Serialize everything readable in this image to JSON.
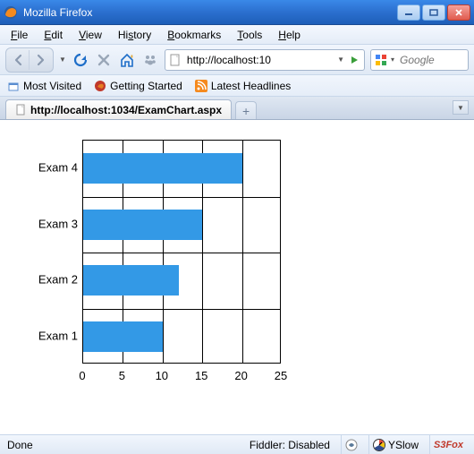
{
  "window": {
    "title": "Mozilla Firefox"
  },
  "menubar": [
    "File",
    "Edit",
    "View",
    "History",
    "Bookmarks",
    "Tools",
    "Help"
  ],
  "toolbar": {
    "reload_icon": "reload-icon",
    "stop_icon": "stop-icon",
    "home_icon": "home-icon",
    "feed_icon": "feed-icon"
  },
  "urlbar": {
    "value": "http://localhost:10"
  },
  "searchbar": {
    "placeholder": "Google"
  },
  "bookmarks": [
    {
      "label": "Most Visited",
      "icon": "most-visited-icon"
    },
    {
      "label": "Getting Started",
      "icon": "getting-started-icon"
    },
    {
      "label": "Latest Headlines",
      "icon": "rss-icon"
    }
  ],
  "tabs": {
    "active_label": "http://localhost:1034/ExamChart.aspx"
  },
  "statusbar": {
    "status": "Done",
    "fiddler": "Fiddler: Disabled",
    "yslow": "YSlow",
    "s3fox": "S3Fox"
  },
  "chart_data": {
    "type": "bar",
    "orientation": "horizontal",
    "categories": [
      "Exam 4",
      "Exam 3",
      "Exam 2",
      "Exam 1"
    ],
    "values": [
      20,
      15,
      12,
      10
    ],
    "xlim": [
      0,
      25
    ],
    "x_ticks": [
      0,
      5,
      10,
      15,
      20,
      25
    ],
    "title": "",
    "xlabel": "",
    "ylabel": ""
  }
}
